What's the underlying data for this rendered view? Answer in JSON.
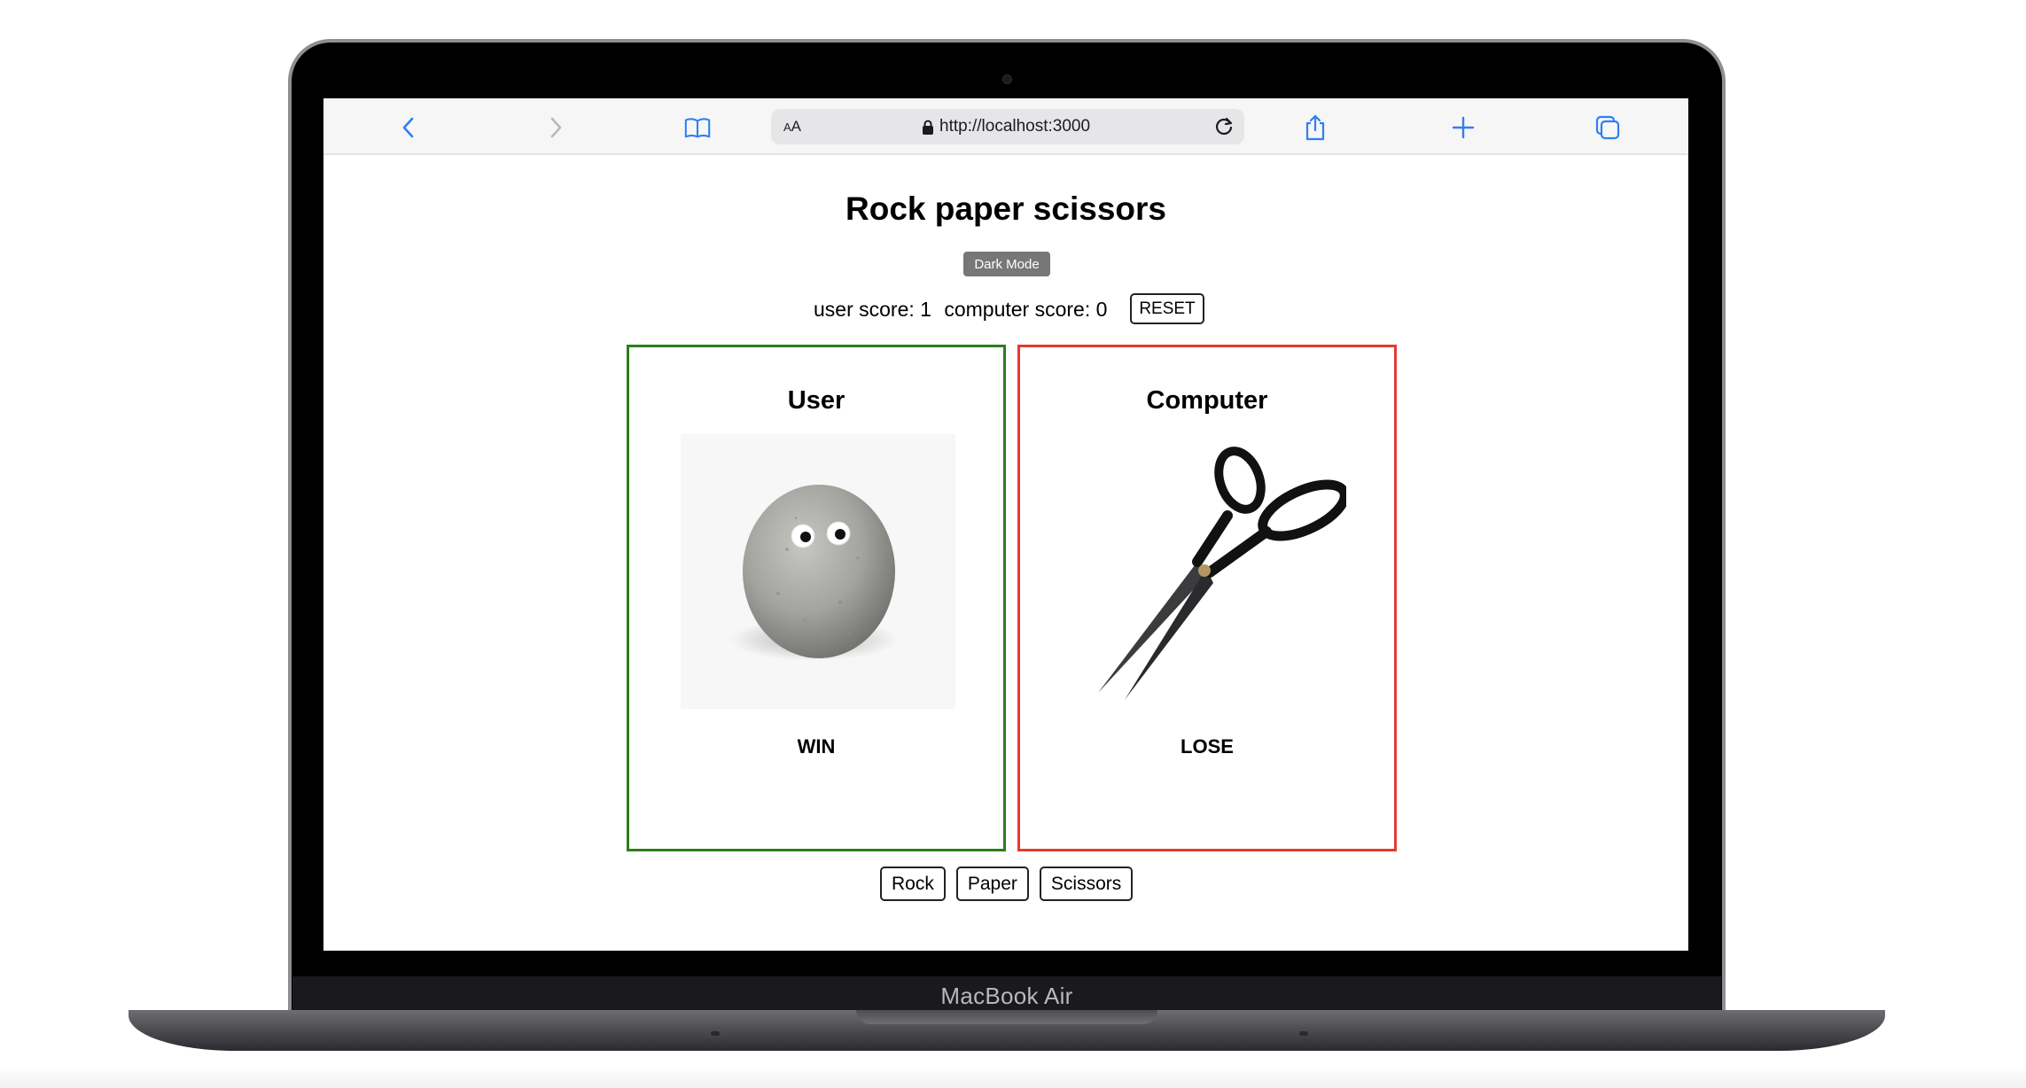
{
  "device": {
    "label": "MacBook Air"
  },
  "browser": {
    "url": "http://localhost:3000",
    "text_size_label": "AA",
    "icons": [
      "back-icon",
      "forward-icon",
      "bookmarks-icon",
      "lock-icon",
      "reload-icon",
      "share-icon",
      "new-tab-icon",
      "tabs-icon"
    ]
  },
  "page": {
    "title": "Rock paper scissors",
    "dark_mode_label": "Dark Mode",
    "user_score_label": "user score: 1",
    "computer_score_label": "computer score: 0",
    "reset_label": "RESET",
    "user_card": {
      "title": "User",
      "choice_image": "rock-with-googly-eyes",
      "result": "WIN",
      "border_color": "#2e7d1e"
    },
    "computer_card": {
      "title": "Computer",
      "choice_image": "scissors",
      "result": "LOSE",
      "border_color": "#e53a2f"
    },
    "choices": [
      "Rock",
      "Paper",
      "Scissors"
    ]
  },
  "colors": {
    "accent": "#2f7ef6",
    "win": "#2e7d1e",
    "lose": "#e53a2f",
    "dark_mode_button": "#777777"
  }
}
